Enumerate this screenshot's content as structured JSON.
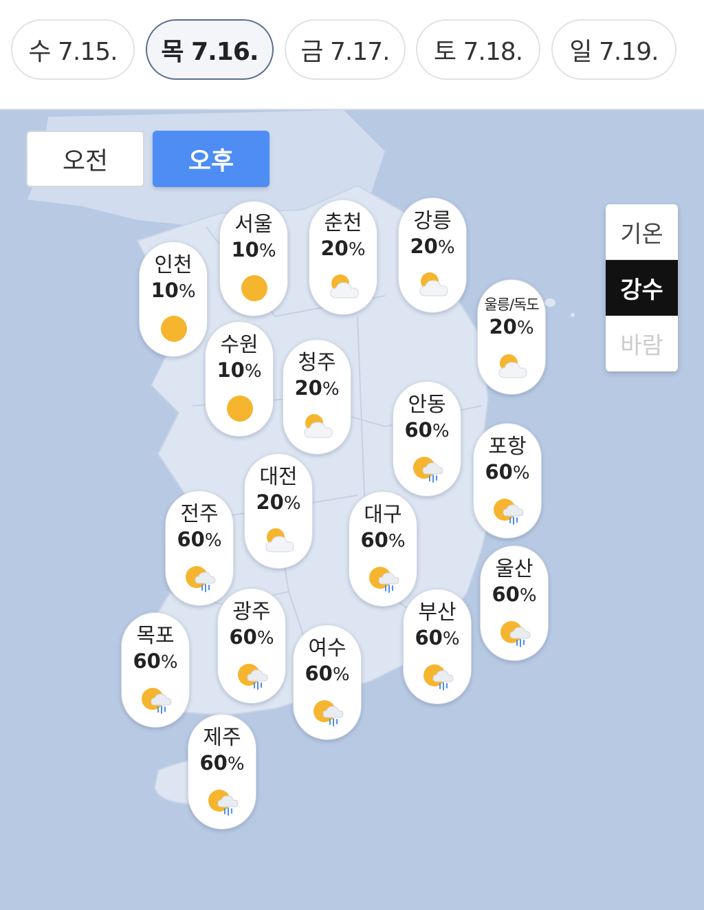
{
  "dates": [
    {
      "label": "수 7.15.",
      "selected": false
    },
    {
      "label": "목 7.16.",
      "selected": true
    },
    {
      "label": "금 7.17.",
      "selected": false
    },
    {
      "label": "토 7.18.",
      "selected": false
    },
    {
      "label": "일 7.19.",
      "selected": false
    }
  ],
  "period": {
    "am": "오전",
    "pm": "오후",
    "selected": "오후"
  },
  "layers": {
    "temp": "기온",
    "rain": "강수",
    "wind": "바람",
    "selected": "강수"
  },
  "percent_sign": "%",
  "cities": [
    {
      "name": "인천",
      "value": "10",
      "icon": "sun-icon"
    },
    {
      "name": "서울",
      "value": "10",
      "icon": "sun-icon"
    },
    {
      "name": "춘천",
      "value": "20",
      "icon": "partly-cloudy-icon"
    },
    {
      "name": "강릉",
      "value": "20",
      "icon": "partly-cloudy-icon"
    },
    {
      "name": "울릉/독도",
      "value": "20",
      "icon": "partly-cloudy-icon"
    },
    {
      "name": "수원",
      "value": "10",
      "icon": "sun-icon"
    },
    {
      "name": "청주",
      "value": "20",
      "icon": "partly-cloudy-icon"
    },
    {
      "name": "안동",
      "value": "60",
      "icon": "sun-cloud-rain-icon"
    },
    {
      "name": "포항",
      "value": "60",
      "icon": "sun-cloud-rain-icon"
    },
    {
      "name": "대전",
      "value": "20",
      "icon": "partly-cloudy-icon"
    },
    {
      "name": "전주",
      "value": "60",
      "icon": "sun-cloud-rain-icon"
    },
    {
      "name": "대구",
      "value": "60",
      "icon": "sun-cloud-rain-icon"
    },
    {
      "name": "울산",
      "value": "60",
      "icon": "sun-cloud-rain-icon"
    },
    {
      "name": "광주",
      "value": "60",
      "icon": "sun-cloud-rain-icon"
    },
    {
      "name": "부산",
      "value": "60",
      "icon": "sun-cloud-rain-icon"
    },
    {
      "name": "목포",
      "value": "60",
      "icon": "sun-cloud-rain-icon"
    },
    {
      "name": "여수",
      "value": "60",
      "icon": "sun-cloud-rain-icon"
    },
    {
      "name": "제주",
      "value": "60",
      "icon": "sun-cloud-rain-icon"
    }
  ],
  "colors": {
    "accent": "#4d8df4",
    "sea": "#b8c9e3",
    "land": "#dde5f2",
    "sun": "#f6b52f"
  }
}
